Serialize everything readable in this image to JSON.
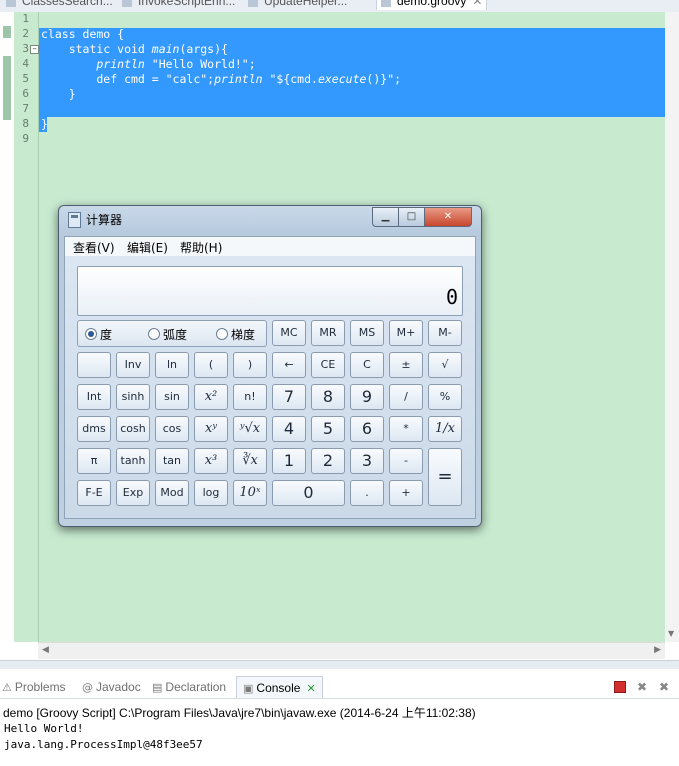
{
  "editor_tabs": [
    {
      "label": "ClassesSearch..."
    },
    {
      "label": "InvokeScriptEnh..."
    },
    {
      "label": "UpdateHelper..."
    },
    {
      "label": "demo.groovy",
      "active": true
    }
  ],
  "editor": {
    "line_numbers": [
      "1",
      "2",
      "3",
      "4",
      "5",
      "6",
      "7",
      "8",
      "9"
    ],
    "code_lines": [
      {
        "segments": [
          {
            "t": ""
          }
        ]
      },
      {
        "segments": [
          {
            "t": "class demo {"
          }
        ]
      },
      {
        "segments": [
          {
            "t": "    static void "
          },
          {
            "t": "main",
            "i": true
          },
          {
            "t": "(args){"
          }
        ]
      },
      {
        "segments": [
          {
            "t": "        "
          },
          {
            "t": "println",
            "i": true
          },
          {
            "t": " \"Hello World!\";"
          }
        ]
      },
      {
        "segments": [
          {
            "t": "        def cmd = \"calc\";"
          },
          {
            "t": "println",
            "i": true
          },
          {
            "t": " \"${cmd."
          },
          {
            "t": "execute",
            "i": true
          },
          {
            "t": "()}\";"
          }
        ]
      },
      {
        "segments": [
          {
            "t": "    }"
          }
        ]
      },
      {
        "segments": [
          {
            "t": ""
          }
        ]
      },
      {
        "segments": [
          {
            "t": "}"
          }
        ]
      },
      {
        "segments": [
          {
            "t": ""
          }
        ]
      }
    ]
  },
  "calculator": {
    "title": "计算器",
    "window_buttons": {
      "minimize": "▁",
      "maximize": "□",
      "close": "✕"
    },
    "menu": [
      "查看(V)",
      "编辑(E)",
      "帮助(H)"
    ],
    "display_value": "0",
    "angle_modes": [
      {
        "label": "度",
        "selected": true
      },
      {
        "label": "弧度",
        "selected": false
      },
      {
        "label": "梯度",
        "selected": false
      }
    ],
    "memory_keys": [
      "MC",
      "MR",
      "MS",
      "M+",
      "M-"
    ],
    "rows": [
      [
        "",
        "Inv",
        "ln",
        "(",
        ")",
        "←",
        "CE",
        "C",
        "±",
        "√"
      ],
      [
        "Int",
        "sinh",
        "sin",
        "x²",
        "n!",
        "7",
        "8",
        "9",
        "/",
        "%"
      ],
      [
        "dms",
        "cosh",
        "cos",
        "xʸ",
        "ʸ√x",
        "4",
        "5",
        "6",
        "*",
        "1/x"
      ],
      [
        "π",
        "tanh",
        "tan",
        "x³",
        "∛x",
        "1",
        "2",
        "3",
        "-",
        "="
      ],
      [
        "F-E",
        "Exp",
        "Mod",
        "log",
        "10ˣ",
        "0",
        ".",
        "+"
      ]
    ]
  },
  "console_tabs": [
    {
      "label": "Problems",
      "icon": "problems-icon"
    },
    {
      "label": "Javadoc",
      "icon": "at-icon"
    },
    {
      "label": "Declaration",
      "icon": "declaration-icon"
    },
    {
      "label": "Console",
      "icon": "console-icon",
      "active": true
    }
  ],
  "console": {
    "description": "demo [Groovy Script] C:\\Program Files\\Java\\jre7\\bin\\javaw.exe (2014-6-24 上午11:02:38)",
    "output": [
      "Hello World!",
      "java.lang.ProcessImpl@48f3ee57"
    ]
  },
  "colors": {
    "editor_bg": "#c8ebd0",
    "selection": "#3399ff",
    "terminate_red": "#d32f2f"
  }
}
